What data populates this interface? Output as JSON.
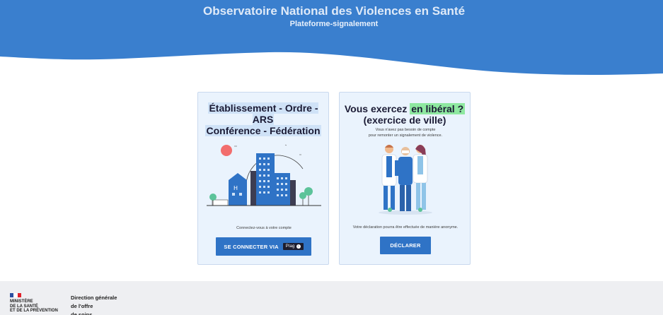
{
  "header": {
    "title": "Observatoire National des Violences en Santé",
    "subtitle": "Plateforme-signalement",
    "color": "#3a7fce"
  },
  "cards": {
    "institution": {
      "title_line1": "Établissement - Ordre - ARS",
      "title_line2": "Conférence - Fédération",
      "description": "Connectez-vous à votre compte",
      "button_label": "SE CONNECTER VIA",
      "badge_label": "Plag",
      "illustration_icon": "hospital-buildings-illustration"
    },
    "liberal": {
      "title_prefix": "Vous exercez ",
      "title_highlight": "en libéral ?",
      "title_line2": "(exercice de ville)",
      "intro_line1": "Vous n'avez pas besoin de compte",
      "intro_line2": "pour remonter un signalement de violence.",
      "description": "Votre déclaration pourra être effectuée de manière anonyme.",
      "button_label": "DÉCLARER",
      "illustration_icon": "health-professionals-illustration"
    }
  },
  "footer": {
    "ministry": "MINISTÈRE\nDE LA SANTÉ\nET DE LA PRÉVENTION",
    "directorate": "Direction générale\nde l'offre\nde soins"
  },
  "colors": {
    "primary_button": "#2f73c6",
    "card_background": "#eaf3fd",
    "highlight_green": "#8ee8a0",
    "footer_background": "#eeeff2"
  }
}
